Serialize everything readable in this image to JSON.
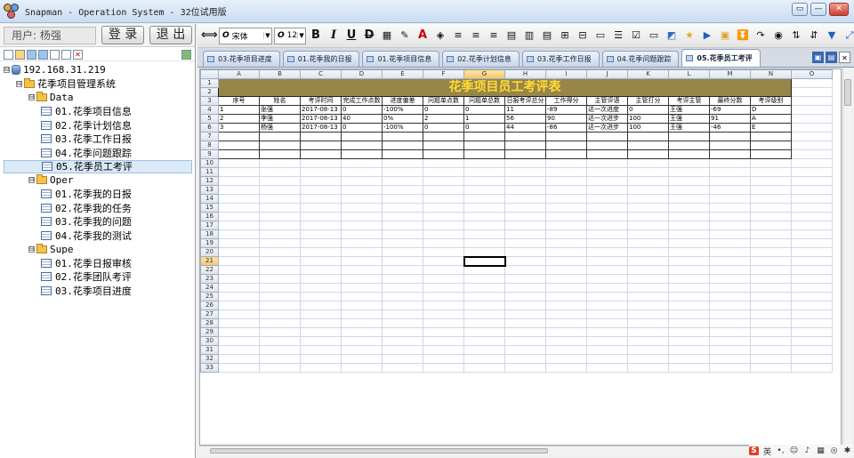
{
  "window": {
    "title": "Snapman - Operation System - 32位试用版",
    "buttons": [
      "▭",
      "—",
      "✕"
    ]
  },
  "left": {
    "user_label": "用户: 杨强",
    "login_label": "登 录",
    "logout_label": "退 出",
    "tree": [
      {
        "level": 0,
        "icon": "db",
        "label": "192.168.31.219",
        "expander": "⊟"
      },
      {
        "level": 1,
        "icon": "folder",
        "label": "花季项目管理系统",
        "expander": "⊟"
      },
      {
        "level": 2,
        "icon": "folder",
        "label": "Data",
        "expander": "⊟"
      },
      {
        "level": 3,
        "icon": "table",
        "label": "01.花季项目信息"
      },
      {
        "level": 3,
        "icon": "table",
        "label": "02.花季计划信息"
      },
      {
        "level": 3,
        "icon": "table",
        "label": "03.花季工作日报"
      },
      {
        "level": 3,
        "icon": "table",
        "label": "04.花季问题跟踪"
      },
      {
        "level": 3,
        "icon": "table",
        "label": "05.花季员工考评",
        "selected": true
      },
      {
        "level": 2,
        "icon": "folder",
        "label": "Oper",
        "expander": "⊟"
      },
      {
        "level": 3,
        "icon": "table",
        "label": "01.花季我的日报"
      },
      {
        "level": 3,
        "icon": "table",
        "label": "02.花季我的任务"
      },
      {
        "level": 3,
        "icon": "table",
        "label": "03.花季我的问题"
      },
      {
        "level": 3,
        "icon": "table",
        "label": "04.花季我的测试"
      },
      {
        "level": 2,
        "icon": "folder",
        "label": "Supe",
        "expander": "⊟"
      },
      {
        "level": 3,
        "icon": "table",
        "label": "01.花季日报审核"
      },
      {
        "level": 3,
        "icon": "table",
        "label": "02.花季团队考评"
      },
      {
        "level": 3,
        "icon": "table",
        "label": "03.花季项目进度"
      }
    ]
  },
  "toolbar": {
    "font_name": "宋体",
    "font_size": "12"
  },
  "tabs": [
    {
      "label": "03.花季项目进度"
    },
    {
      "label": "01.花季我的日报"
    },
    {
      "label": "01.花季项目信息"
    },
    {
      "label": "02.花季计划信息"
    },
    {
      "label": "03.花季工作日报"
    },
    {
      "label": "04.花季问题跟踪"
    },
    {
      "label": "05.花季员工考评",
      "active": true
    }
  ],
  "sheet": {
    "columns": [
      "A",
      "B",
      "C",
      "D",
      "E",
      "F",
      "G",
      "H",
      "I",
      "J",
      "K",
      "L",
      "M",
      "N",
      "O"
    ],
    "selected_column": "G",
    "selected_row": 21,
    "row_count": 33,
    "title": "花季项目员工考评表",
    "headers": [
      "序号",
      "姓名",
      "考评时间",
      "完成工作点数",
      "进度偏差",
      "问题单点数",
      "问题单总数",
      "日报考评总分",
      "工作得分",
      "主管评语",
      "主管打分",
      "考评主管",
      "最终分数",
      "考评级别"
    ],
    "rows": [
      [
        "1",
        "张强",
        "2017-08-13",
        "0",
        "-100%",
        "0",
        "0",
        "11",
        "-89",
        "达一次进度",
        "0",
        "王强",
        "-69",
        "D"
      ],
      [
        "2",
        "李强",
        "2017-08-13",
        "40",
        "0%",
        "2",
        "1",
        "56",
        "90",
        "达一次进步",
        "100",
        "王强",
        "91",
        "A"
      ],
      [
        "3",
        "杨强",
        "2017-08-13",
        "0",
        "-100%",
        "0",
        "0",
        "44",
        "-86",
        "达一次进步",
        "100",
        "王强",
        "-46",
        "E"
      ]
    ]
  }
}
